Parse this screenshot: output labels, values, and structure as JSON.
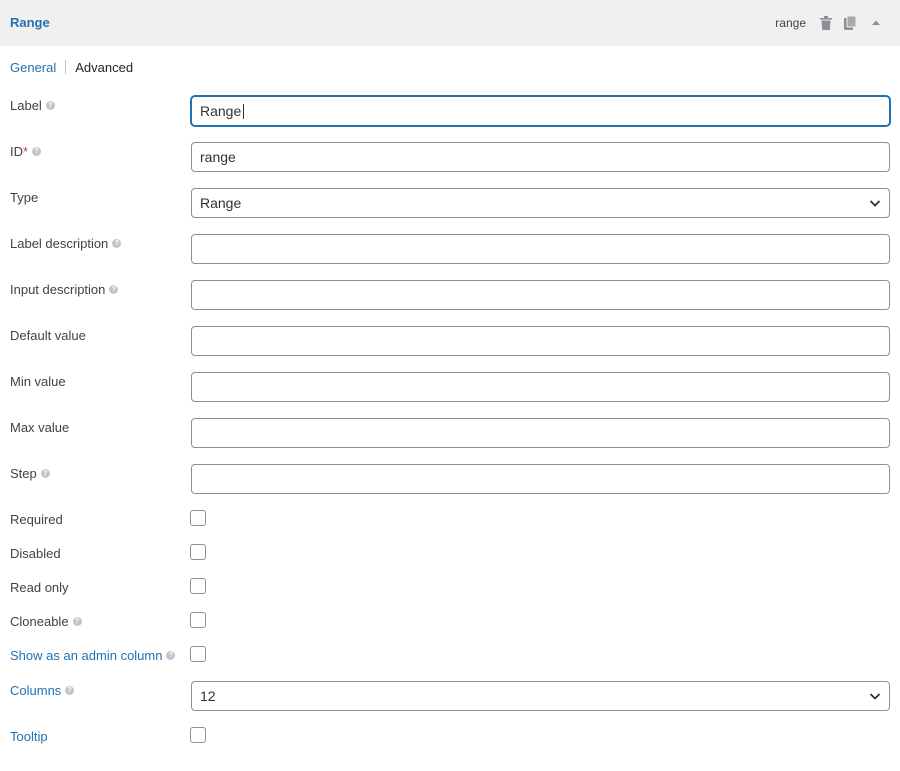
{
  "header": {
    "title": "Range",
    "field_id": "range",
    "icons": [
      "trash-icon",
      "duplicate-icon",
      "collapse-arrow-icon"
    ]
  },
  "tabs": [
    {
      "label": "General",
      "active": true
    },
    {
      "label": "Advanced",
      "active": false
    }
  ],
  "fields": {
    "label": {
      "label": "Label",
      "value": "Range",
      "help": true
    },
    "id": {
      "label": "ID",
      "required_mark": "*",
      "value": "range",
      "help": true
    },
    "type": {
      "label": "Type",
      "value": "Range"
    },
    "label_description": {
      "label": "Label description",
      "value": "",
      "help": true
    },
    "input_description": {
      "label": "Input description",
      "value": "",
      "help": true
    },
    "default_value": {
      "label": "Default value",
      "value": ""
    },
    "min_value": {
      "label": "Min value",
      "value": ""
    },
    "max_value": {
      "label": "Max value",
      "value": ""
    },
    "step": {
      "label": "Step",
      "value": "",
      "help": true
    },
    "required": {
      "label": "Required",
      "checked": false
    },
    "disabled": {
      "label": "Disabled",
      "checked": false
    },
    "read_only": {
      "label": "Read only",
      "checked": false
    },
    "cloneable": {
      "label": "Cloneable",
      "checked": false,
      "help": true
    },
    "admin_column": {
      "label": "Show as an admin column",
      "checked": false,
      "help": true
    },
    "columns": {
      "label": "Columns",
      "value": "12",
      "help": true
    },
    "tooltip": {
      "label": "Tooltip",
      "checked": false
    }
  },
  "colors": {
    "accent": "#2271b1",
    "header_bg": "#f0f0f1",
    "border": "#8c8f94",
    "required": "#d63638"
  }
}
